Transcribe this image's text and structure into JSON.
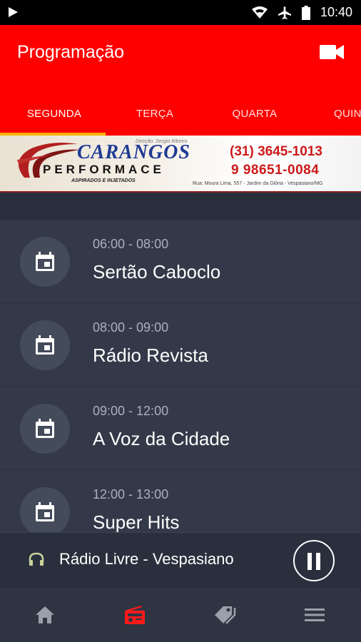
{
  "status_bar": {
    "time": "10:40"
  },
  "app_bar": {
    "title": "Programação"
  },
  "tabs": [
    {
      "label": "SEGUNDA",
      "active": true
    },
    {
      "label": "TERÇA",
      "active": false
    },
    {
      "label": "QUARTA",
      "active": false
    },
    {
      "label": "QUIN",
      "active": false
    }
  ],
  "ad": {
    "tagline": "Direção: Sergio Ribeiro",
    "brand": "CARANGOS",
    "brand_sub": "PERFORMACE",
    "brand_note": "ASPIRADOS E INJETADOS",
    "phone1": "(31) 3645-1013",
    "phone2": "9 98651-0084",
    "address": "Rua: Moura Lima, 557 - Jardim da Glória - Vespasiano/MG"
  },
  "schedule": [
    {
      "time": "06:00 - 08:00",
      "title": "Sertão Caboclo"
    },
    {
      "time": "08:00 - 09:00",
      "title": "Rádio Revista"
    },
    {
      "time": "09:00 - 12:00",
      "title": "A Voz da Cidade"
    },
    {
      "time": "12:00 - 13:00",
      "title": "Super Hits"
    }
  ],
  "player": {
    "station": "Rádio Livre - Vespasiano",
    "state": "playing"
  },
  "bottom_nav": [
    {
      "icon": "home-icon",
      "active": false
    },
    {
      "icon": "radio-icon",
      "active": true
    },
    {
      "icon": "tag-icon",
      "active": false
    },
    {
      "icon": "menu-icon",
      "active": false
    }
  ],
  "colors": {
    "app_bar": "#ff0000",
    "tab_indicator": "#f4b400",
    "background": "#2a2f3d",
    "list_row": "#333948",
    "nav_active": "#ff1a1a",
    "nav_inactive": "#9aa0aa"
  }
}
